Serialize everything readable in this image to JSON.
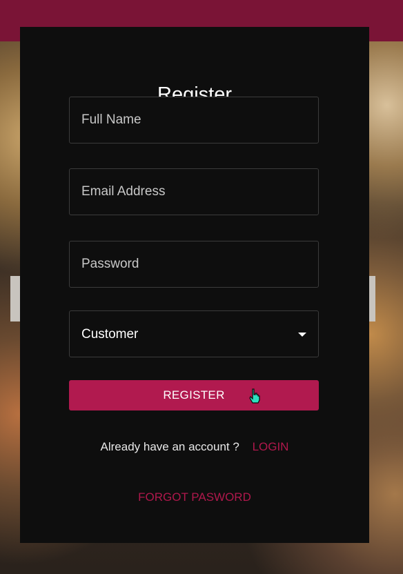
{
  "form": {
    "title": "Register",
    "full_name_placeholder": "Full Name",
    "email_placeholder": "Email Address",
    "password_placeholder": "Password",
    "role_selected": "Customer",
    "register_label": "REGISTER",
    "already_text": "Already have an account ?",
    "login_label": "LOGIN",
    "forgot_label": "FORGOT PASWORD"
  },
  "colors": {
    "accent": "#b11a4f",
    "top_bar": "#7a1436",
    "modal_bg": "#0e0e0e"
  },
  "icons": {
    "select_caret": "chevron-down-icon",
    "cursor": "hand-pointer-icon"
  }
}
